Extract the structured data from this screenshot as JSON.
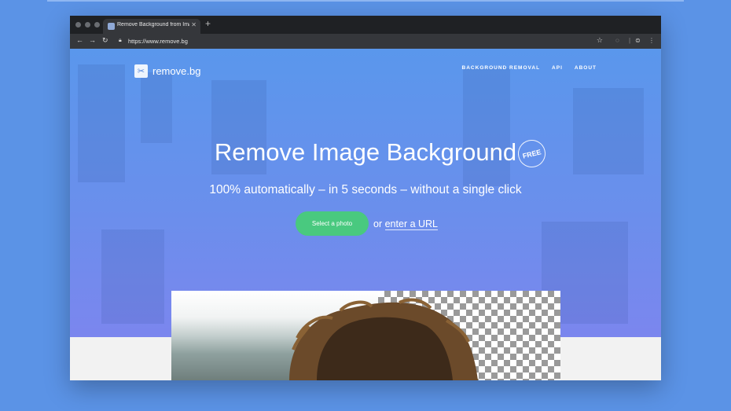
{
  "browser": {
    "tab_title": "Remove Background from Imag",
    "url": "https://www.remove.bg"
  },
  "site": {
    "logo_text": "remove.bg",
    "nav": [
      "BACKGROUND REMOVAL",
      "API",
      "ABOUT"
    ]
  },
  "hero": {
    "headline": "Remove Image Background",
    "badge": "FREE",
    "subline": "100% automatically – in 5 seconds – without a single click",
    "cta_label": "Select a photo",
    "or_text": "or",
    "url_link": "enter a URL"
  },
  "colors": {
    "page_bg": "#5b93e6",
    "cta_green": "#49c97f",
    "hero_top": "#5a97ec",
    "hero_bottom": "#7b86ee"
  }
}
